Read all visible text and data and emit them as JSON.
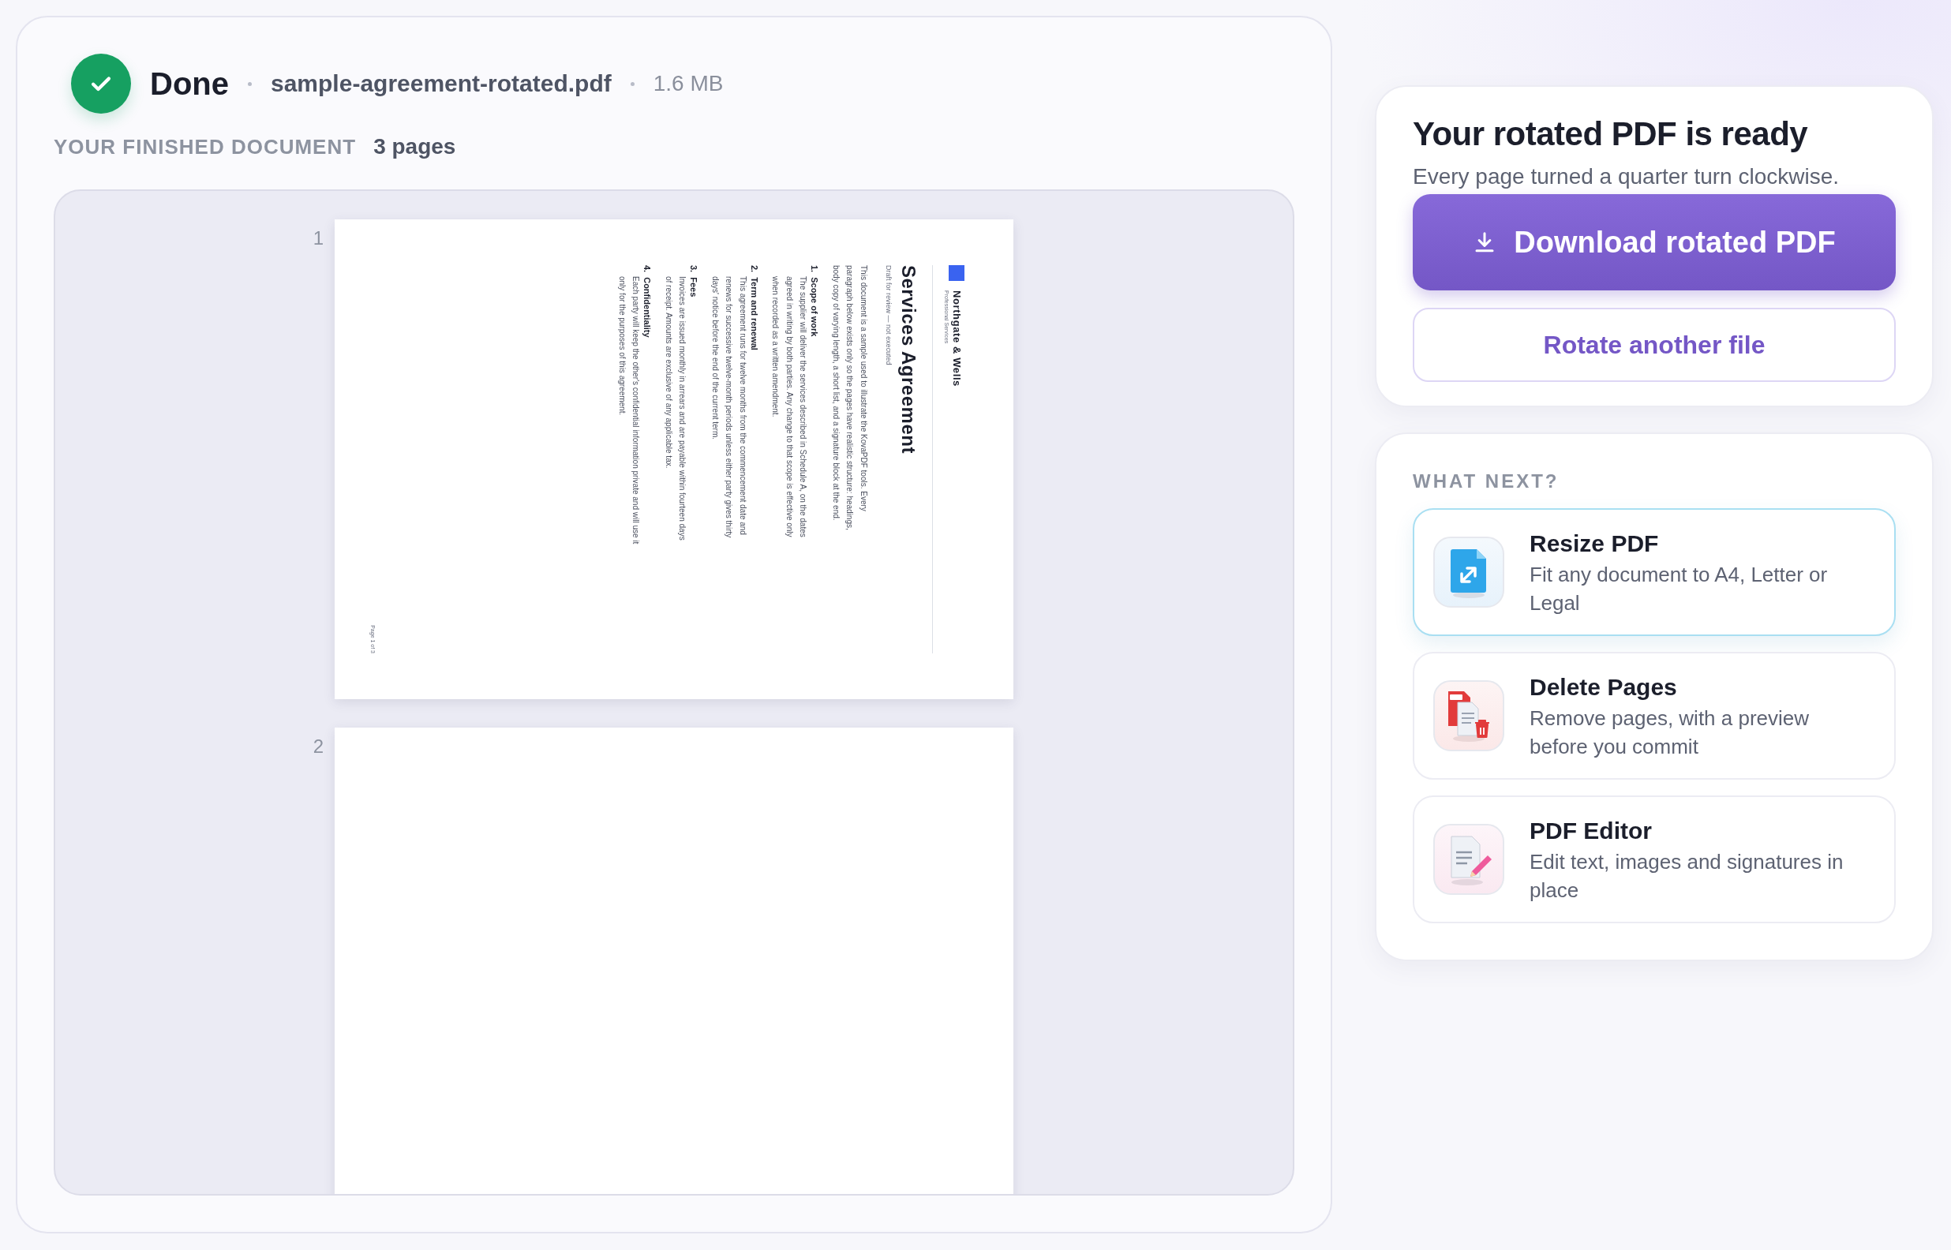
{
  "status": {
    "label": "Done",
    "filename": "sample-agreement-rotated.pdf",
    "size": "1.6 MB"
  },
  "document": {
    "heading": "YOUR FINISHED DOCUMENT",
    "page_count": "3 pages",
    "pages": [
      {
        "number": "1",
        "kind": "content",
        "company": "Northgate & Wells",
        "tagline": "Professional Services",
        "title": "Services Agreement",
        "subtitle": "Draft for review — not executed",
        "intro": "This document is a sample used to illustrate the KovaPDF tools. Every paragraph below exists only so the pages have realistic structure: headings, body copy of varying length, a short list, and a signature block at the end.",
        "sections": [
          {
            "number": "1.",
            "heading": "Scope of work",
            "body": "The supplier will deliver the services described in Schedule A, on the dates agreed in writing by both parties. Any change to that scope is effective only when recorded as a written amendment."
          },
          {
            "number": "2.",
            "heading": "Term and renewal",
            "body": "This agreement runs for twelve months from the commencement date and renews for successive twelve-month periods unless either party gives thirty days' notice before the end of the current term."
          },
          {
            "number": "3.",
            "heading": "Fees",
            "body": "Invoices are issued monthly in arrears and are payable within fourteen days of receipt. Amounts are exclusive of any applicable tax."
          },
          {
            "number": "4.",
            "heading": "Confidentiality",
            "body": "Each party will keep the other's confidential information private and will use it only for the purposes of this agreement."
          }
        ],
        "footer": "Page 1 of 3"
      },
      {
        "number": "2",
        "kind": "blank"
      }
    ]
  },
  "result": {
    "title": "Your rotated PDF is ready",
    "subtitle": "Every page turned a quarter turn clockwise.",
    "download": "Download rotated PDF",
    "again": "Rotate another file"
  },
  "next": {
    "heading": "WHAT NEXT?",
    "items": [
      {
        "title": "Resize PDF",
        "description": "Fit any document to A4, Letter or Legal",
        "selected": true
      },
      {
        "title": "Delete Pages",
        "description": "Remove pages, with a preview before you commit",
        "selected": false
      },
      {
        "title": "PDF Editor",
        "description": "Edit text, images and signatures in place",
        "selected": false
      }
    ]
  }
}
